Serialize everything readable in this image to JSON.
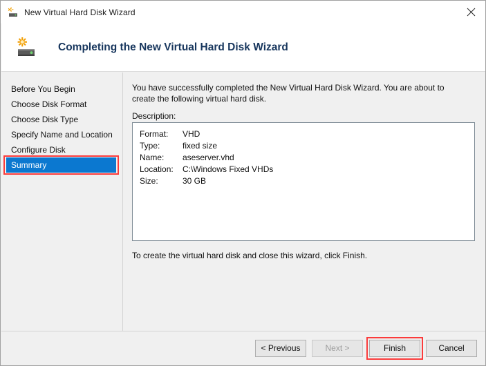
{
  "window": {
    "title": "New Virtual Hard Disk Wizard",
    "title_icon": "virtual-hard-disk-icon",
    "close_label": "×"
  },
  "header": {
    "icon": "virtual-hard-disk-icon",
    "title": "Completing the New Virtual Hard Disk Wizard",
    "title_color": "#17365D"
  },
  "nav": {
    "items": [
      {
        "label": "Before You Begin",
        "selected": false
      },
      {
        "label": "Choose Disk Format",
        "selected": false
      },
      {
        "label": "Choose Disk Type",
        "selected": false
      },
      {
        "label": "Specify Name and Location",
        "selected": false
      },
      {
        "label": "Configure Disk",
        "selected": false
      },
      {
        "label": "Summary",
        "selected": true
      }
    ],
    "selected_bg": "#0B78D0",
    "selected_fg": "#FFFFFF",
    "highlight_box_color": "#FB3B3B"
  },
  "content": {
    "intro": "You have successfully completed the New Virtual Hard Disk Wizard. You are about to create the following virtual hard disk.",
    "description_label": "Description:",
    "description_rows": [
      {
        "key": "Format:",
        "value": "VHD"
      },
      {
        "key": "Type:",
        "value": "fixed size"
      },
      {
        "key": "Name:",
        "value": "aseserver.vhd"
      },
      {
        "key": "Location:",
        "value": "C:\\Windows Fixed VHDs"
      },
      {
        "key": "Size:",
        "value": "30 GB"
      }
    ],
    "outro": "To create the virtual hard disk and close this wizard, click Finish."
  },
  "footer": {
    "previous_label": "< Previous",
    "next_label": "Next >",
    "finish_label": "Finish",
    "cancel_label": "Cancel",
    "next_disabled": true,
    "finish_highlight_color": "#FB3B3B"
  }
}
